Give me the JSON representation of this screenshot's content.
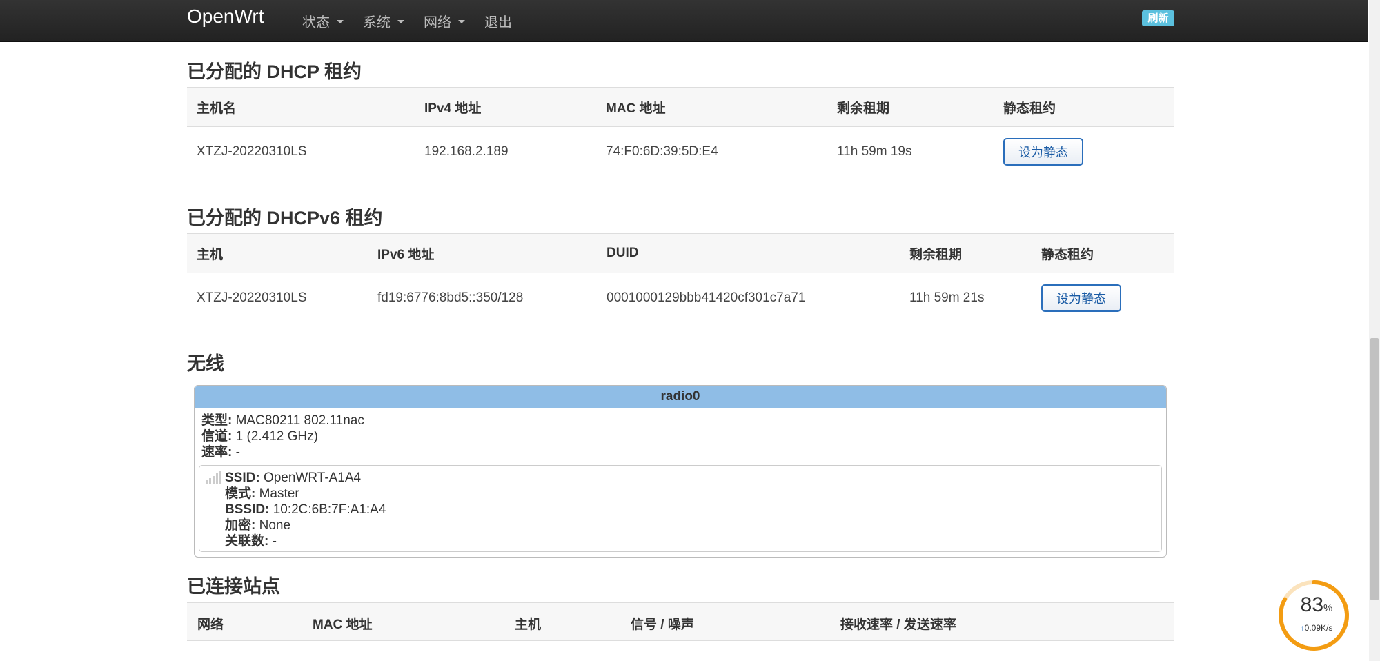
{
  "navbar": {
    "brand": "OpenWrt",
    "menus": [
      {
        "label": "状态"
      },
      {
        "label": "系统"
      },
      {
        "label": "网络"
      }
    ],
    "logout": "退出",
    "refresh_badge": "刷新"
  },
  "dhcp": {
    "title": "已分配的 DHCP 租约",
    "headers": [
      "主机名",
      "IPv4 地址",
      "MAC 地址",
      "剩余租期",
      "静态租约"
    ],
    "rows": [
      {
        "hostname": "XTZJ-20220310LS",
        "ipv4": "192.168.2.189",
        "mac": "74:F0:6D:39:5D:E4",
        "lease": "11h 59m 19s",
        "button": "设为静态"
      }
    ]
  },
  "dhcpv6": {
    "title": "已分配的 DHCPv6 租约",
    "headers": [
      "主机",
      "IPv6 地址",
      "DUID",
      "剩余租期",
      "静态租约"
    ],
    "rows": [
      {
        "host": "XTZJ-20220310LS",
        "ipv6": "fd19:6776:8bd5::350/128",
        "duid": "0001000129bbb41420cf301c7a71",
        "lease": "11h 59m 21s",
        "button": "设为静态"
      }
    ]
  },
  "wireless": {
    "title": "无线",
    "radio": {
      "name": "radio0",
      "type_label": "类型:",
      "type_value": " MAC80211 802.11nac",
      "channel_label": "信道:",
      "channel_value": " 1 (2.412 GHz)",
      "rate_label": "速率:",
      "rate_value": " -",
      "network": {
        "ssid_label": "SSID:",
        "ssid_value": " OpenWRT-A1A4",
        "mode_label": "模式:",
        "mode_value": " Master",
        "bssid_label": "BSSID:",
        "bssid_value": " 10:2C:6B:7F:A1:A4",
        "enc_label": "加密:",
        "enc_value": " None",
        "assoc_label": "关联数:",
        "assoc_value": " -"
      }
    }
  },
  "stations": {
    "title": "已连接站点",
    "headers": [
      "网络",
      "MAC 地址",
      "主机",
      "信号 / 噪声",
      "接收速率 / 发送速率"
    ]
  },
  "gauge": {
    "percent": "83",
    "percent_unit": "%",
    "fraction": 0.83,
    "speed": "0.09K/s",
    "speed_arrow": "↑"
  },
  "colors": {
    "navbar": "#222222",
    "radio_header": "#8fbde6",
    "button_border": "#2a6ebb",
    "gauge": "#f39c12",
    "badge": "#5bc0de"
  }
}
